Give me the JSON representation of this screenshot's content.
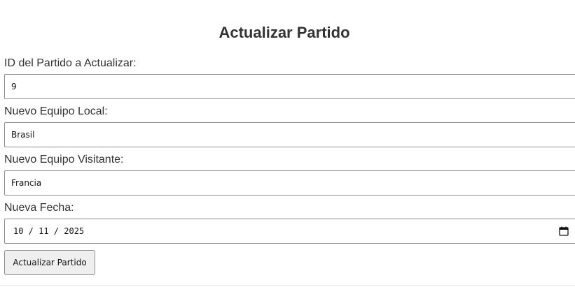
{
  "form": {
    "title": "Actualizar Partido",
    "id_label": "ID del Partido a Actualizar:",
    "id_value": "9",
    "local_label": "Nuevo Equipo Local:",
    "local_value": "Brasil",
    "visitante_label": "Nuevo Equipo Visitante:",
    "visitante_value": "Francia",
    "fecha_label": "Nueva Fecha:",
    "fecha_value": "10 / 11 / 2025",
    "fecha_icon": "calendar-icon",
    "submit_label": "Actualizar Partido"
  }
}
